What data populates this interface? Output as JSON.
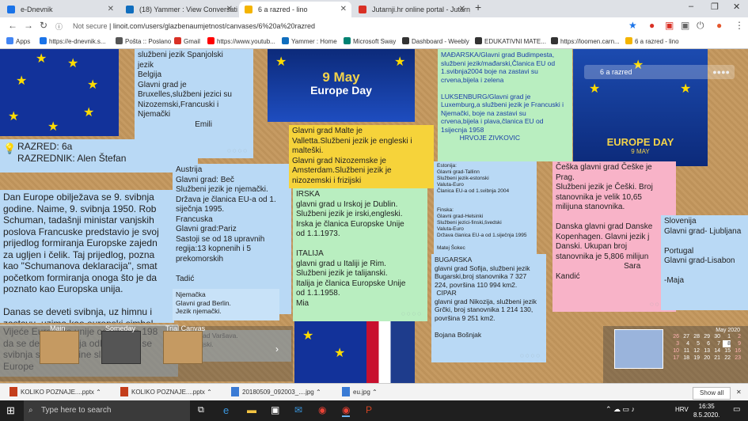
{
  "browser": {
    "tabs": [
      {
        "label": "e-Dnevnik",
        "color": "#1a73e8"
      },
      {
        "label": "(18) Yammer : View Conversation",
        "color": "#106ebe"
      },
      {
        "label": "6 a razred - lino",
        "color": "#f4b400"
      },
      {
        "label": "Jutarnji.hr online portal - Jutarnj",
        "color": "#d93025"
      }
    ],
    "new_tab": "+",
    "window_controls": [
      "–",
      "❐",
      "✕"
    ],
    "address": {
      "not_secure": "Not secure",
      "url": "linoit.com/users/glazbenaumjetnost/canvases/6%20a%20razred"
    },
    "bookmarks": [
      {
        "label": "Apps",
        "color": "#4285f4"
      },
      {
        "label": "https://e-dnevnik.s...",
        "color": "#1a73e8"
      },
      {
        "label": "Pošta :: Poslano",
        "color": "#555555"
      },
      {
        "label": "Gmail",
        "color": "#d93025"
      },
      {
        "label": "https://www.youtub...",
        "color": "#ff0000"
      },
      {
        "label": "Yammer : Home",
        "color": "#106ebe"
      },
      {
        "label": "Microsoft Sway",
        "color": "#008272"
      },
      {
        "label": "Dashboard - Weebly",
        "color": "#333333"
      },
      {
        "label": "EDUKATIVNI MATE...",
        "color": "#333333"
      },
      {
        "label": "https://loomen.carn...",
        "color": "#333333"
      },
      {
        "label": "6 a razred - lino",
        "color": "#f4b400"
      }
    ]
  },
  "board": {
    "europe_day_banner": {
      "line1": "9 May",
      "line2": "Europe Day"
    },
    "europe_day_right": {
      "line1": "EUROPE DAY",
      "line2": "9 MAY"
    },
    "canvas_label": "6 a razred",
    "notes": {
      "spain": "službeni jezik Spanjolski\njezik\nBelgija\nGlavni grad je\nBruxelles,službeni jezici su\nNizozemski,Francuski i\nNjemački\n                          Emili",
      "hungary": "MAĐARSKA/Glavni grad Budimpesta,\nslužbeni jezik/mađarski,Članica EU od\n1.svibnja2004 boje na zastavi su\ncrvena,bijela i zelena\n\nLUKSENBURG/Glavni grad je\nLuxemburg,a službeni jezik je Francuski i\nNjemački, boje na zastavi su\ncrvena,bijela i plava,članica EU od\n1sijecnja 1958\n          HRVOJE ZIVKOVIC",
      "header": "RAZRED: 6a\nRAZREDNIK: Alen Štefan",
      "intro": "Dan Europe obilježava se 9. svibnja\ngodine. Naime, 9. svibnja 1950. Rob\nSchuman, tadašnji ministar vanjskih\nposlova Francuske predstavio je svoj\nprijedlog formiranja Europske zajedn\nza ugljen i čelik. Taj prijedlog, pozna\nkao \"Schumanova deklaracija\", smat\npočetkom formiranja onoga što je da\npoznato kao Europska unija.\n\nDanas se deveti svibnja, uz himnu i\nzastavu, uzima kao europski simbol.",
      "austria": "Austrija\nGlavni grad: Beč\nSlužbeni jezik je njemački.\nDržava je članica EU-a od 1.\nsiječnja 1995.\nFrancuska\nGlavni grad:Pariz\nSastoji se od 18 upravnih\nregija:13 kopnenih i 5\nprekomorskih\n\nTadić",
      "germany": "Njemačka\nGlavni grad Berlin.\nJezik njemački.",
      "malta": "Glavni grad Malte je\nValletta.Službeni jezik je engleski i\nmalteški.\nGlavni grad Nizozemske je\nAmsterdam.Službeni jezik je\nnizozemski i frizijski",
      "ireland": "IRSKA\nglavni grad u Irskoj je Dublin.\nSlužbeni jezik je irski,engleski.\nIrska je članica Europske Unije\nod 1.1.1973.\n\nITALIJA\nglavni grad u Italiji je Rim.\nSlužbeni jezik je talijanski.\nItalija je članica Europske Unije\nod 1.1.1958.\nMia",
      "estonia": "Estonija:\nGlavni grad-Tallinn\nSlužbeni jezik-estonski\nValuta-Euro\nČlanica EU-a od 1.svibnja 2004\n\n\nFinska:\nGlavni grad-Helsinki\nSlužbeni jezici-finski,švedski\nValuta-Euro\nDržava članica EU-a od 1.siječnja 1995\n\nMatej Šokec",
      "bulgaria": "BUGARSKA\nglavni grad Sofija, službeni jezik\nBugarski,broj stanovnika 7 327\n224, površina 110 994 km2.\n CIPAR\nglavni grad Nikozija, službeni jezik\nGrčki, broj stanovnika 1 214 130,\npovršina 9 251 km2.\n\nBojana Bošnjak",
      "czech": "Češka glavni grad Češke je\nPrag.\nSlužbeni jezik je Češki. Broj\nstanovnika je velik 10,65\nmilijuna stanovnika.\n\nDanska glavni grad Danske\nKopenhagen. Glavni jezik j\nDanski. Ukupan broj\nstanovnika je 5,806 milijun\n                               Sara\nKandić",
      "slovenia": "Slovenija\nGlavni grad- Ljubljana\n\nPortugal\nGlavni grad-Lisabon\n\n-Maja",
      "bottom_left": "Vijeće Europske unije odlučilo je 198\nda se deveti svibnja odlučiti kom se\nsvibnja svake godine slavi kao\nEurope",
      "croatia_fragment": "Glavni grad Varšava.\nJezik poljski."
    },
    "trays": [
      {
        "label": "Main"
      },
      {
        "label": "Someday"
      },
      {
        "label": "Trial Canvas"
      }
    ],
    "mini_calendar": {
      "month": "May 2020",
      "rows": [
        [
          "26",
          "27",
          "28",
          "29",
          "30",
          "1",
          "2"
        ],
        [
          "3",
          "4",
          "5",
          "6",
          "7",
          "8",
          "9"
        ],
        [
          "10",
          "11",
          "12",
          "13",
          "14",
          "15",
          "16"
        ],
        [
          "17",
          "18",
          "19",
          "20",
          "21",
          "22",
          "23"
        ]
      ]
    }
  },
  "downloads": [
    {
      "label": "KOLIKO POZNAJE....pptx",
      "color": "#c43e1c"
    },
    {
      "label": "KOLIKO POZNAJE....pptx",
      "color": "#c43e1c"
    },
    {
      "label": "20180509_092003_....jpg",
      "color": "#3a7bd5"
    },
    {
      "label": "eu.jpg",
      "color": "#3a7bd5"
    }
  ],
  "show_all": "Show all",
  "taskbar": {
    "search_placeholder": "Type here to search",
    "lang": "HRV",
    "time": "16:35",
    "date": "8.5.2020."
  }
}
